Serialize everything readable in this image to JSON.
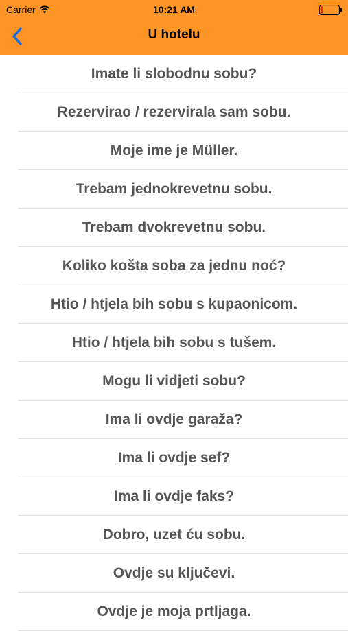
{
  "status_bar": {
    "carrier": "Carrier",
    "time": "10:21 AM"
  },
  "nav": {
    "title": "U hotelu",
    "back_icon": "chevron-left-icon",
    "accent_color": "#FD9426",
    "back_color": "#1A6BE0"
  },
  "phrases": [
    "Imate li slobodnu sobu?",
    "Rezervirao / rezervirala sam sobu.",
    "Moje ime je Müller.",
    "Trebam jednokrevetnu sobu.",
    "Trebam dvokrevetnu sobu.",
    "Koliko košta soba za jednu noć?",
    "Htio / htjela bih sobu s kupaonicom.",
    "Htio / htjela bih sobu s tušem.",
    "Mogu li vidjeti sobu?",
    "Ima li ovdje garaža?",
    "Ima li ovdje sef?",
    "Ima li ovdje faks?",
    "Dobro, uzet ću sobu.",
    "Ovdje su ključevi.",
    "Ovdje je moja prtljaga."
  ]
}
